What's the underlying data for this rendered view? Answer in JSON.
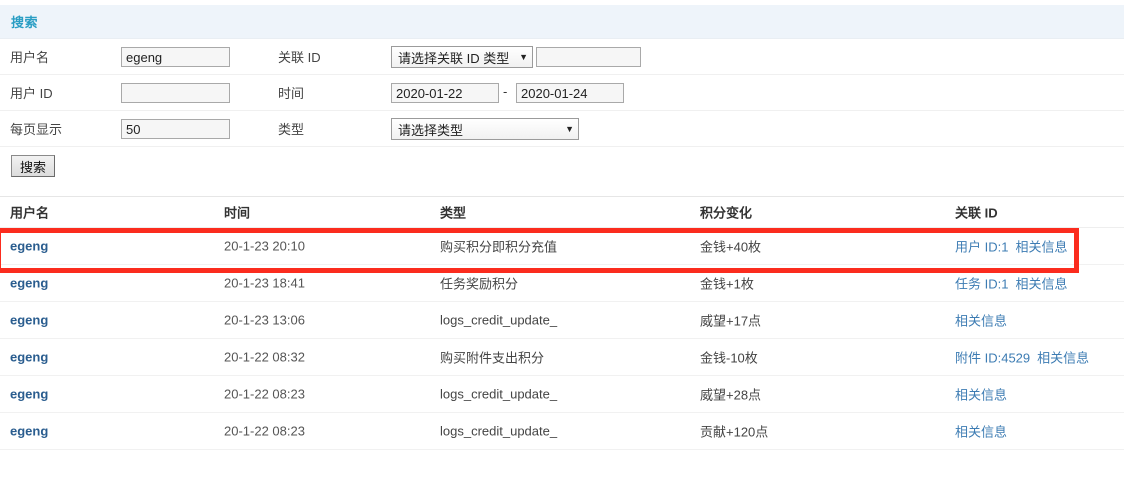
{
  "search_panel": {
    "title": "搜索",
    "fields": {
      "username_label": "用户名",
      "username_value": "egeng",
      "rel_id_label": "关联 ID",
      "rel_id_select_value": "请选择关联 ID 类型",
      "rel_id_input_value": "",
      "user_id_label": "用户 ID",
      "user_id_value": "",
      "time_label": "时间",
      "date_from": "2020-01-22",
      "date_separator": "-",
      "date_to": "2020-01-24",
      "per_page_label": "每页显示",
      "per_page_value": "50",
      "type_label": "类型",
      "type_select_value": "请选择类型",
      "caret_glyph": "▼"
    },
    "search_button_label": "搜索"
  },
  "results": {
    "headers": {
      "username": "用户名",
      "time": "时间",
      "type": "类型",
      "credit_change": "积分变化",
      "rel_id": "关联 ID"
    },
    "rows": [
      {
        "username": "egeng",
        "time": "20-1-23 20:10",
        "type": "购买积分即积分充值",
        "credit_change": "金钱+40枚",
        "rel_id_link": "用户 ID:1",
        "info_link": "相关信息",
        "highlighted": true
      },
      {
        "username": "egeng",
        "time": "20-1-23 18:41",
        "type": "任务奖励积分",
        "credit_change": "金钱+1枚",
        "rel_id_link": "任务 ID:1",
        "info_link": "相关信息",
        "highlighted": false
      },
      {
        "username": "egeng",
        "time": "20-1-23 13:06",
        "type": "logs_credit_update_",
        "credit_change": "威望+17点",
        "rel_id_link": "",
        "info_link": "相关信息",
        "highlighted": false
      },
      {
        "username": "egeng",
        "time": "20-1-22 08:32",
        "type": "购买附件支出积分",
        "credit_change": "金钱-10枚",
        "rel_id_link": "附件 ID:4529",
        "info_link": "相关信息",
        "highlighted": false
      },
      {
        "username": "egeng",
        "time": "20-1-22 08:23",
        "type": "logs_credit_update_",
        "credit_change": "威望+28点",
        "rel_id_link": "",
        "info_link": "相关信息",
        "highlighted": false
      },
      {
        "username": "egeng",
        "time": "20-1-22 08:23",
        "type": "logs_credit_update_",
        "credit_change": "贡献+120点",
        "rel_id_link": "",
        "info_link": "相关信息",
        "highlighted": false
      }
    ]
  },
  "annotation": {
    "highlight_color": "#fb2c1e",
    "highlight_row_index": 0
  }
}
